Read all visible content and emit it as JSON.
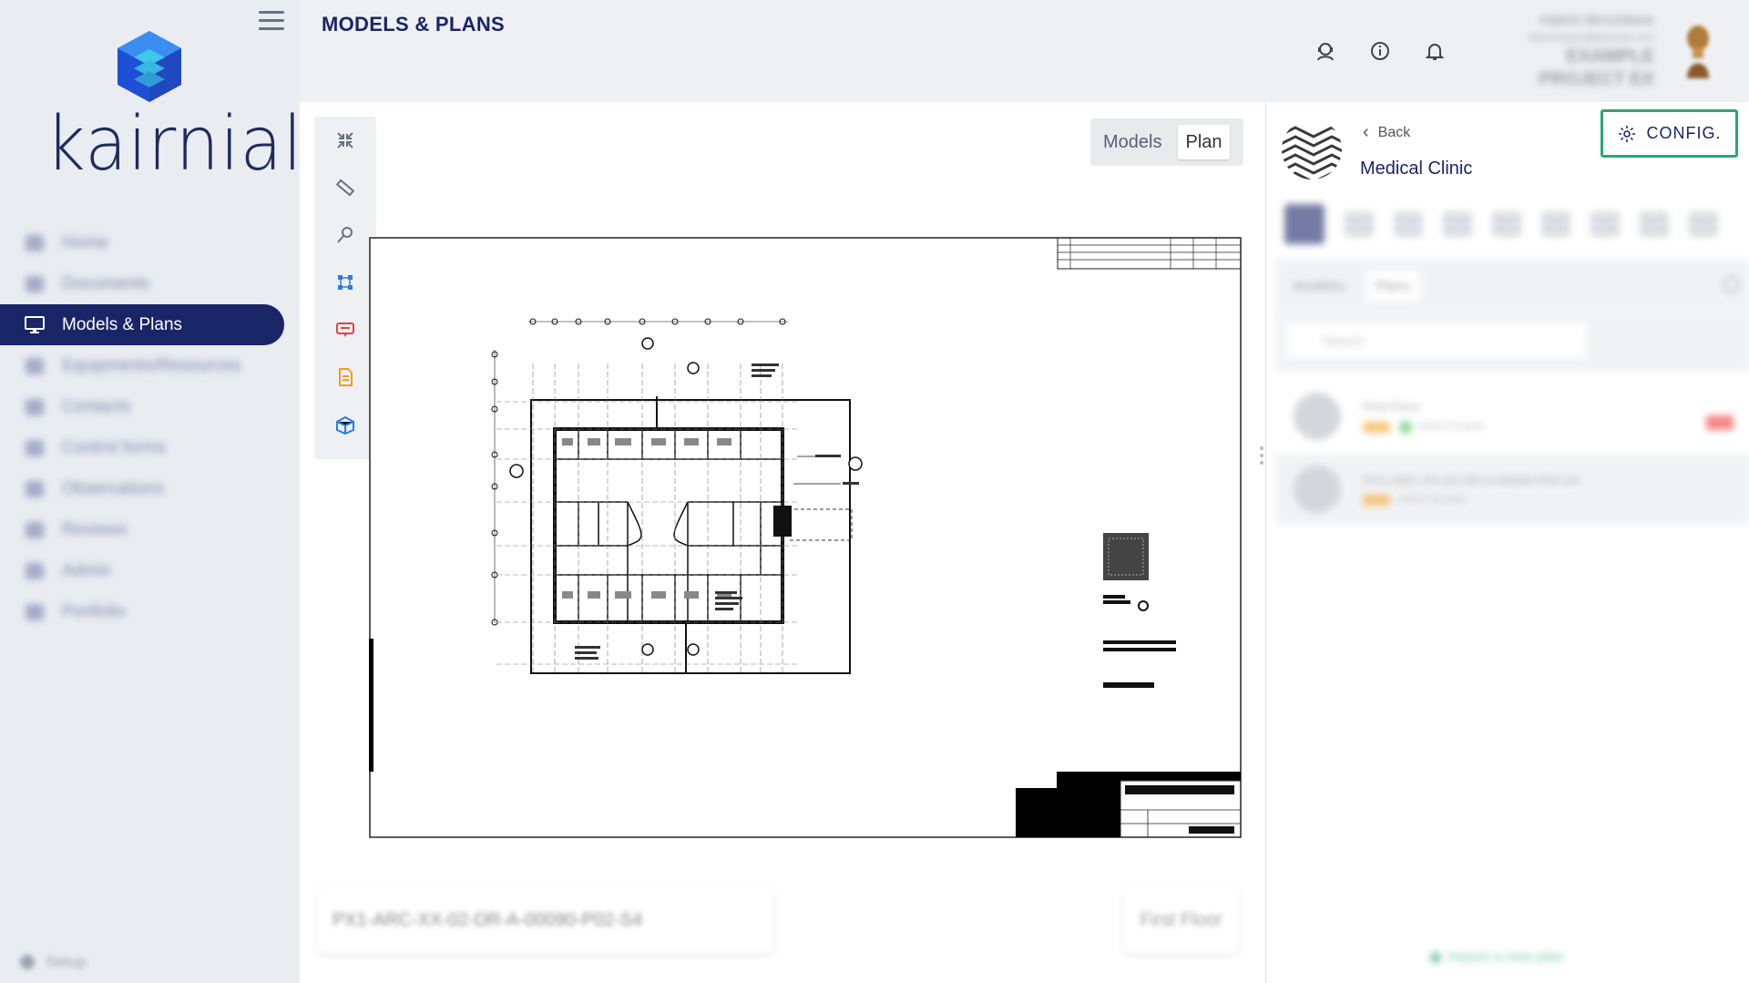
{
  "app": {
    "logo_text": "kairnial",
    "page_title": "MODELS & PLANS"
  },
  "sidebar": {
    "items": [
      {
        "label": "Home",
        "icon": "home-icon",
        "active": false
      },
      {
        "label": "Documents",
        "icon": "document-icon",
        "active": false
      },
      {
        "label": "Models & Plans",
        "icon": "monitor-icon",
        "active": true
      },
      {
        "label": "Equipments/Resources",
        "icon": "equipment-icon",
        "active": false
      },
      {
        "label": "Contacts",
        "icon": "contacts-icon",
        "active": false
      },
      {
        "label": "Control forms",
        "icon": "form-icon",
        "active": false
      },
      {
        "label": "Observations",
        "icon": "observation-icon",
        "active": false
      },
      {
        "label": "Reviews",
        "icon": "review-icon",
        "active": false
      },
      {
        "label": "Admin",
        "icon": "admin-icon",
        "active": false
      },
      {
        "label": "Portfolio",
        "icon": "portfolio-icon",
        "active": false
      }
    ],
    "setup_label": "Setup"
  },
  "header": {
    "user_name": "Hakim Benzidane",
    "user_email": "hbenzidane@kairnial.com",
    "project_line1": "EXAMPLE",
    "project_line2": "PROJECT EX",
    "icons": [
      "support-icon",
      "info-icon",
      "bell-icon"
    ]
  },
  "viewer": {
    "view_toggle": {
      "models_label": "Models",
      "plan_label": "Plan",
      "selected": "Plan"
    },
    "tools": [
      "collapse-icon",
      "ruler-icon",
      "pin-icon",
      "bim-connect-icon",
      "annotation-icon",
      "report-icon",
      "package-icon"
    ],
    "tool_colors": [
      "#6b7280",
      "#6b7280",
      "#6b7280",
      "#2a7be4",
      "#e0453a",
      "#f0a020",
      "#2a7be4"
    ],
    "plan_name_field": "PX1-ARC-XX-02-DR-A-00090-P02-S4",
    "level_button": "First Floor"
  },
  "right_panel": {
    "back_label": "Back",
    "project_name": "Medical Clinic",
    "config_label": "CONFIG.",
    "config_border_color": "#27a872",
    "subtabs": [
      "Modèles",
      "Plans"
    ],
    "search_placeholder": "Search",
    "plans": [
      {
        "title": "First Floor",
        "tag": "FIRST FLOOR",
        "status": "green"
      },
      {
        "title": "PX1-ARC-XX-02-DR-A-00090-P02-S4",
        "tag": "FIRST FLOOR",
        "status": "selected"
      }
    ],
    "import_label": "Import a new plan"
  }
}
